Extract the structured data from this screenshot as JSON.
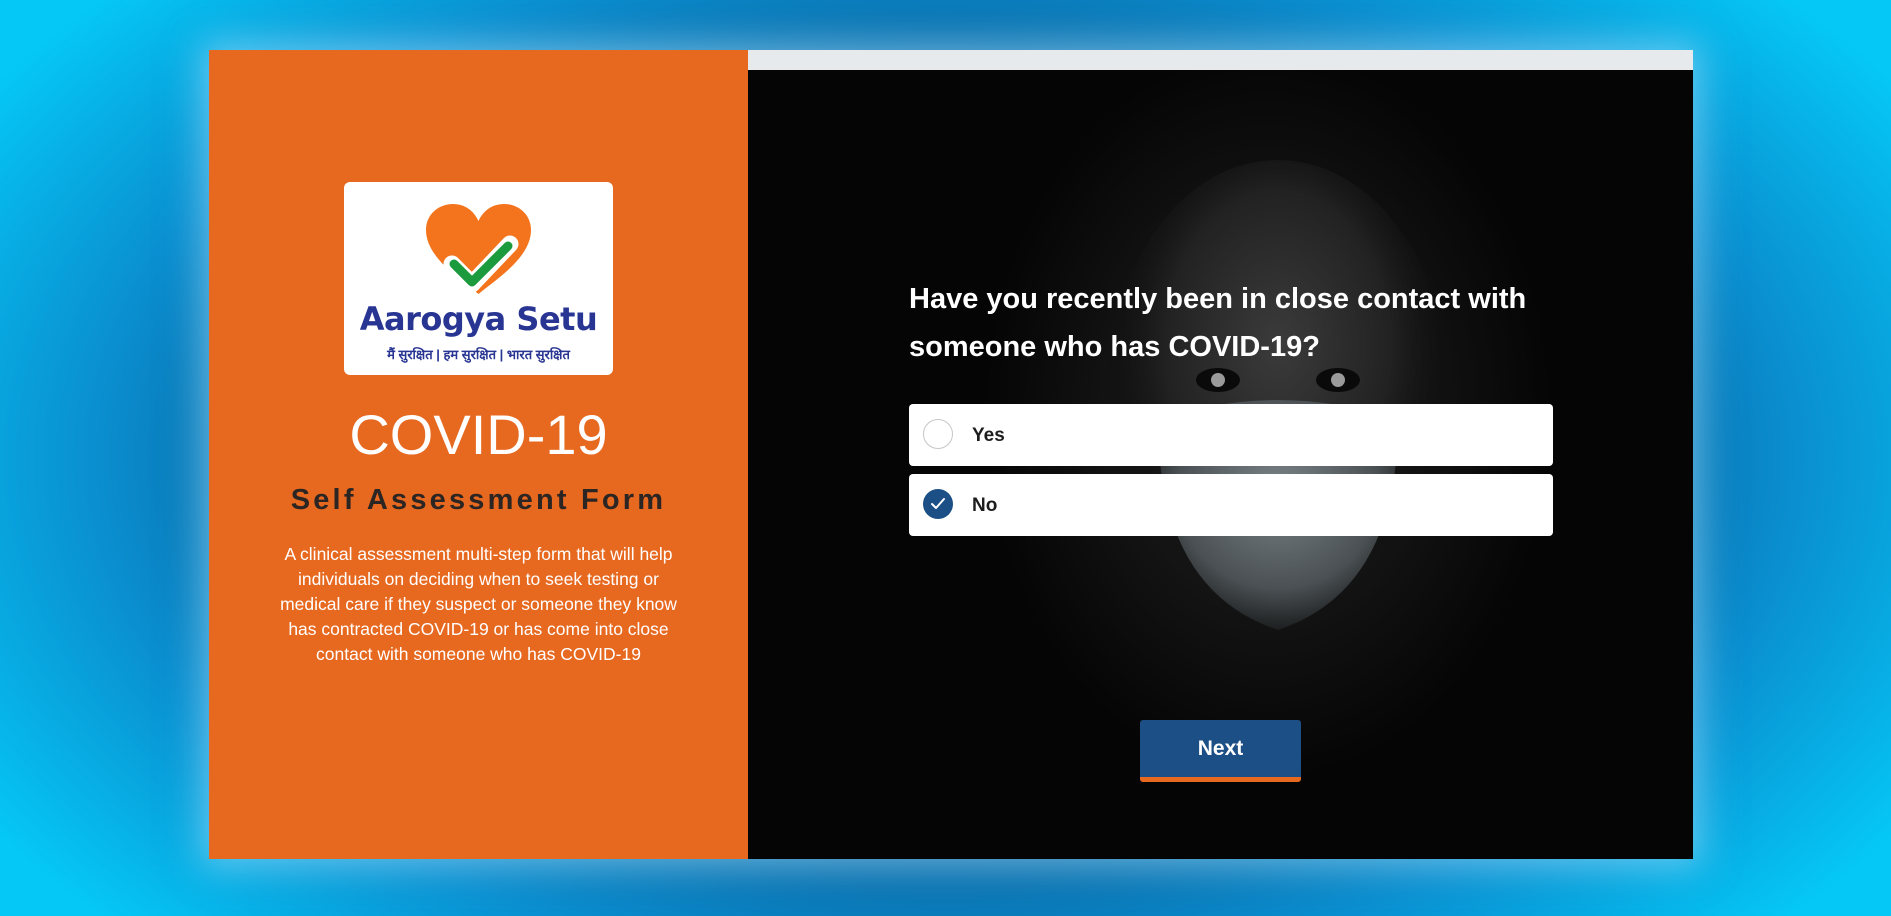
{
  "brand": {
    "logo_wordmark": "Aarogya Setu",
    "logo_tagline": "मैं सुरक्षित  |  हम सुरक्षित  |  भारत सुरक्षित",
    "title": "COVID-19",
    "subtitle": "Self Assessment Form",
    "description": "A clinical assessment multi-step form that will help individuals on deciding when to seek testing or medical care if they suspect or someone they know has contracted COVID-19 or has come into close contact with someone who has COVID-19"
  },
  "question": {
    "text": "Have you recently been in close contact with someone who has COVID-19?",
    "options": [
      {
        "label": "Yes",
        "selected": false
      },
      {
        "label": "No",
        "selected": true
      }
    ]
  },
  "actions": {
    "next_label": "Next"
  },
  "colors": {
    "brand_orange": "#e7681f",
    "accent_blue": "#1c4f86",
    "logo_navy": "#283593",
    "logo_green": "#1b9a3e"
  },
  "icons": {
    "heart": "heart-icon",
    "check": "checkmark-icon"
  }
}
